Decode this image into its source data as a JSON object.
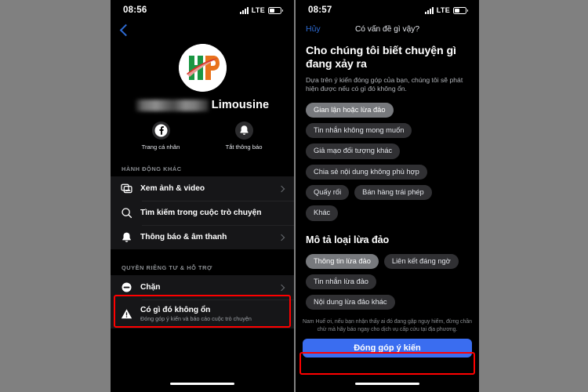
{
  "left_phone": {
    "status_bar": {
      "time": "08:56",
      "network": "LTE",
      "signal_icon": "signal-bars-icon",
      "battery_icon": "battery-icon"
    },
    "back_button_icon": "chevron-left-icon",
    "profile": {
      "avatar_icon": "hp-limousine-logo",
      "name_redacted": true,
      "name_visible": "Limousine"
    },
    "quick_actions": [
      {
        "icon": "facebook-icon",
        "label": "Trang cá nhân"
      },
      {
        "icon": "bell-icon",
        "label": "Tắt thông báo"
      }
    ],
    "sections": [
      {
        "header": "HÀNH ĐỘNG KHÁC",
        "rows": [
          {
            "icon": "photos-videos-icon",
            "title": "Xem ảnh & video",
            "subtitle": "",
            "chevron": true
          },
          {
            "icon": "search-icon",
            "title": "Tìm kiếm trong cuộc trò chuyện",
            "subtitle": "",
            "chevron": false
          },
          {
            "icon": "bell-icon",
            "title": "Thông báo & âm thanh",
            "subtitle": "",
            "chevron": true
          }
        ]
      },
      {
        "header": "QUYỀN RIÊNG TƯ & HỖ TRỢ",
        "rows": [
          {
            "icon": "block-icon",
            "title": "Chặn",
            "subtitle": "",
            "chevron": true
          },
          {
            "icon": "warning-triangle-icon",
            "title": "Có gì đó không ổn",
            "subtitle": "Đóng góp ý kiến và báo cáo cuộc trò chuyện",
            "chevron": false
          }
        ]
      }
    ]
  },
  "right_phone": {
    "status_bar": {
      "time": "08:57",
      "network": "LTE",
      "signal_icon": "signal-bars-icon",
      "battery_icon": "battery-icon"
    },
    "modal": {
      "cancel_label": "Hủy",
      "title": "Có vấn đề gì vậy?",
      "heading": "Cho chúng tôi biết chuyện gì đang xảy ra",
      "subheading": "Dựa trên ý kiến đóng góp của bạn, chúng tôi sẽ phát hiện được nếu có gì đó không ổn.",
      "reason_chips": [
        {
          "label": "Gian lận hoặc lừa đảo",
          "selected": true
        },
        {
          "label": "Tin nhắn không mong muốn",
          "selected": false
        },
        {
          "label": "Giả mạo đối tượng khác",
          "selected": false
        },
        {
          "label": "Chia sẻ nội dung không phù hợp",
          "selected": false
        },
        {
          "label": "Quấy rối",
          "selected": false
        },
        {
          "label": "Bán hàng trái phép",
          "selected": false
        },
        {
          "label": "Khác",
          "selected": false
        }
      ],
      "detail_section_title": "Mô tả loại lừa đảo",
      "detail_chips": [
        {
          "label": "Thông tin lừa đảo",
          "selected": true
        },
        {
          "label": "Liên kết đáng ngờ",
          "selected": false
        },
        {
          "label": "Tin nhắn lừa đảo",
          "selected": false
        },
        {
          "label": "Nội dung lừa đảo khác",
          "selected": false
        }
      ],
      "disclaimer": "Nam Huế ơi, nếu bạn nhận thấy ai đó đang gặp nguy hiểm, đừng chần chừ mà hãy báo ngay cho dịch vụ cấp cứu tại địa phương.",
      "submit_label": "Đóng góp ý kiến"
    }
  },
  "colors": {
    "accent_blue": "#3a6df0",
    "link_blue": "#2d6bd4",
    "highlight_red": "#ff0000",
    "card_bg": "#161618",
    "chip_bg": "#303033",
    "chip_selected_bg": "#77797d",
    "page_bg": "#808080"
  }
}
